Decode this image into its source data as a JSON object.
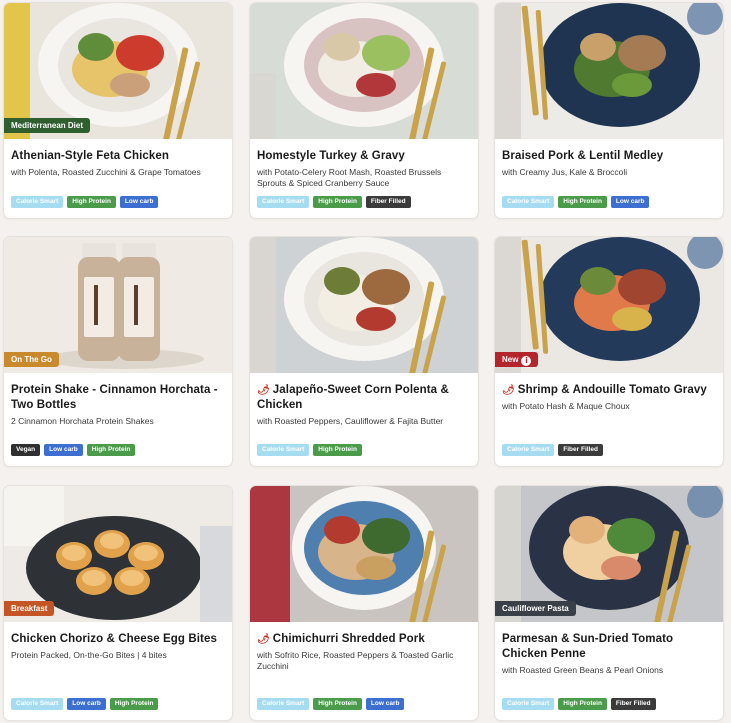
{
  "colors": {
    "calorie_smart": "#a6dcf1",
    "high_protein": "#4a9c4a",
    "low_carb": "#3d6fd0",
    "fiber_filled": "#3b3b3b",
    "vegan": "#2f2f2f",
    "spicy_icon": "#c8321f"
  },
  "meals": [
    {
      "title": "Athenian-Style Feta Chicken",
      "subtitle": "with Polenta, Roasted Zucchini & Grape Tomatoes",
      "tag": "Mediterranean Diet",
      "tag_color": "#2f5e2f",
      "badges": [
        "Calorie Smart",
        "High Protein",
        "Low carb"
      ]
    },
    {
      "title": "Homestyle Turkey & Gravy",
      "subtitle": "with Potato-Celery Root Mash, Roasted Brussels Sprouts & Spiced Cranberry Sauce",
      "badges": [
        "Calorie Smart",
        "High Protein",
        "Fiber Filled"
      ]
    },
    {
      "title": "Braised Pork & Lentil Medley",
      "subtitle": "with Creamy Jus, Kale & Broccoli",
      "badges": [
        "Calorie Smart",
        "High Protein",
        "Low carb"
      ]
    },
    {
      "title": "Protein Shake - Cinnamon Horchata - Two Bottles",
      "subtitle": "2 Cinnamon Horchata Protein Shakes",
      "tag": "On The Go",
      "tag_color": "#c98a2e",
      "badges": [
        "Vegan",
        "Low carb",
        "High Protein"
      ]
    },
    {
      "title": "Jalapeño-Sweet Corn Polenta & Chicken",
      "subtitle": "with Roasted Peppers, Cauliflower & Fajita Butter",
      "spicy": "chili-icon",
      "badges": [
        "Calorie Smart",
        "High Protein"
      ]
    },
    {
      "title": "Shrimp & Andouille Tomato Gravy",
      "subtitle": "with Potato Hash & Maque Choux",
      "spicy": "chili-icon",
      "tag": "New",
      "tag_color": "#b5252c",
      "tag_icon": "info-icon",
      "badges": [
        "Calorie Smart",
        "Fiber Filled"
      ]
    },
    {
      "title": "Chicken Chorizo & Cheese Egg Bites",
      "subtitle": "Protein Packed, On-the-Go Bites | 4 bites",
      "tag": "Breakfast",
      "tag_color": "#c45524",
      "badges": [
        "Calorie Smart",
        "Low carb",
        "High Protein"
      ]
    },
    {
      "title": "Chimichurri Shredded Pork",
      "subtitle": "with Sofrito Rice, Roasted Peppers & Toasted Garlic Zucchini",
      "spicy": "chili-icon",
      "badges": [
        "Calorie Smart",
        "High Protein",
        "Low carb"
      ]
    },
    {
      "title": "Parmesan & Sun-Dried Tomato Chicken Penne",
      "subtitle": "with Roasted Green Beans & Pearl Onions",
      "tag": "Cauliflower Pasta",
      "tag_color": "#3a4048",
      "badges": [
        "Calorie Smart",
        "High Protein",
        "Fiber Filled"
      ]
    }
  ]
}
